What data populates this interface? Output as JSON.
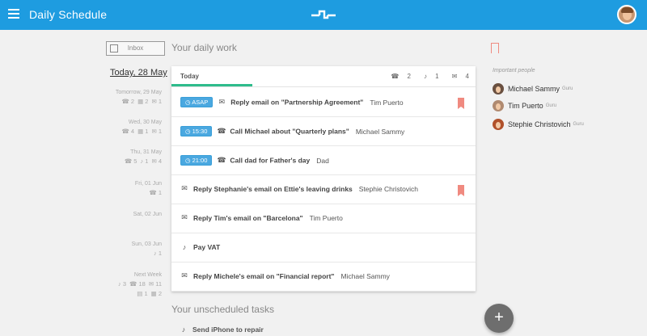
{
  "app": {
    "title": "Daily  Schedule",
    "colors": {
      "accent": "#1e9ce0",
      "tab_underline": "#2ebc8c",
      "flag": "#f08a80",
      "badge": "#4aa8e0"
    }
  },
  "sidebar": {
    "inbox_label": "Inbox",
    "today": "Today, 28 May",
    "days": [
      {
        "name": "Tomorrow, 29 May",
        "counts": [
          {
            "icon": "phone-icon",
            "glyph": "☎",
            "value": "2"
          },
          {
            "icon": "calendar-icon",
            "glyph": "▦",
            "value": "2"
          },
          {
            "icon": "mail-icon",
            "glyph": "✉",
            "value": "1"
          }
        ]
      },
      {
        "name": "Wed, 30 May",
        "counts": [
          {
            "icon": "phone-icon",
            "glyph": "☎",
            "value": "4"
          },
          {
            "icon": "calendar-icon",
            "glyph": "▦",
            "value": "1"
          },
          {
            "icon": "mail-icon",
            "glyph": "✉",
            "value": "1"
          }
        ]
      },
      {
        "name": "Thu, 31 May",
        "counts": [
          {
            "icon": "phone-icon",
            "glyph": "☎",
            "value": "5"
          },
          {
            "icon": "bell-icon",
            "glyph": "♪",
            "value": "1"
          },
          {
            "icon": "mail-icon",
            "glyph": "✉",
            "value": "4"
          }
        ]
      },
      {
        "name": "Fri, 01 Jun",
        "counts": [
          {
            "icon": "phone-icon",
            "glyph": "☎",
            "value": "1"
          }
        ]
      },
      {
        "name": "Sat, 02 Jun",
        "counts": []
      },
      {
        "name": "Sun, 03 Jun",
        "counts": [
          {
            "icon": "bell-icon",
            "glyph": "♪",
            "value": "1"
          }
        ]
      },
      {
        "name": "Next Week",
        "counts": [
          {
            "icon": "bell-icon",
            "glyph": "♪",
            "value": "3"
          },
          {
            "icon": "phone-icon",
            "glyph": "☎",
            "value": "18"
          },
          {
            "icon": "mail-icon",
            "glyph": "✉",
            "value": "11"
          }
        ],
        "counts2": [
          {
            "icon": "document-icon",
            "glyph": "▤",
            "value": "1"
          },
          {
            "icon": "calendar-icon",
            "glyph": "▦",
            "value": "2"
          }
        ]
      }
    ]
  },
  "main": {
    "daily_title": "Your daily work",
    "tab_label": "Today",
    "header_counts": [
      {
        "icon": "phone-icon",
        "glyph": "☎",
        "value": "2"
      },
      {
        "icon": "bell-icon",
        "glyph": "♪",
        "value": "1"
      },
      {
        "icon": "mail-icon",
        "glyph": "✉",
        "value": "4"
      }
    ],
    "tasks": [
      {
        "badge": "ASAP",
        "icon": "mail-icon",
        "glyph": "✉",
        "title": "Reply email on \"Partnership Agreement\"",
        "person": "Tim Puerto",
        "flag": true
      },
      {
        "badge": "15:30",
        "icon": "phone-icon",
        "glyph": "☎",
        "title": "Call Michael about \"Quarterly plans\"",
        "person": "Michael Sammy",
        "flag": false
      },
      {
        "badge": "21:00",
        "icon": "phone-icon",
        "glyph": "☎",
        "title": "Call dad for Father's day",
        "person": "Dad",
        "flag": false
      },
      {
        "badge": "",
        "icon": "mail-icon",
        "glyph": "✉",
        "title": "Reply Stephanie's email on Ettie's leaving drinks",
        "person": "Stephie Christovich",
        "flag": true
      },
      {
        "badge": "",
        "icon": "mail-icon",
        "glyph": "✉",
        "title": "Reply Tim's email on \"Barcelona\"",
        "person": "Tim Puerto",
        "flag": false
      },
      {
        "badge": "",
        "icon": "bell-icon",
        "glyph": "♪",
        "title": "Pay VAT",
        "person": "",
        "flag": false
      },
      {
        "badge": "",
        "icon": "mail-icon",
        "glyph": "✉",
        "title": "Reply Michele's email on \"Financial report\"",
        "person": "Michael Sammy",
        "flag": false
      }
    ],
    "unscheduled_title": "Your unscheduled tasks",
    "unscheduled": [
      {
        "icon": "bell-icon",
        "glyph": "♪",
        "title": "Send iPhone to repair"
      }
    ]
  },
  "people": {
    "label": "Important people",
    "list": [
      {
        "name": "Michael Sammy",
        "role": "Guru",
        "avatar_color": "#6a5040"
      },
      {
        "name": "Tim Puerto",
        "role": "Guru",
        "avatar_color": "#b08a70"
      },
      {
        "name": "Stephie Christovich",
        "role": "Guru",
        "avatar_color": "#b0502a"
      }
    ]
  },
  "fab": {
    "label": "+"
  }
}
